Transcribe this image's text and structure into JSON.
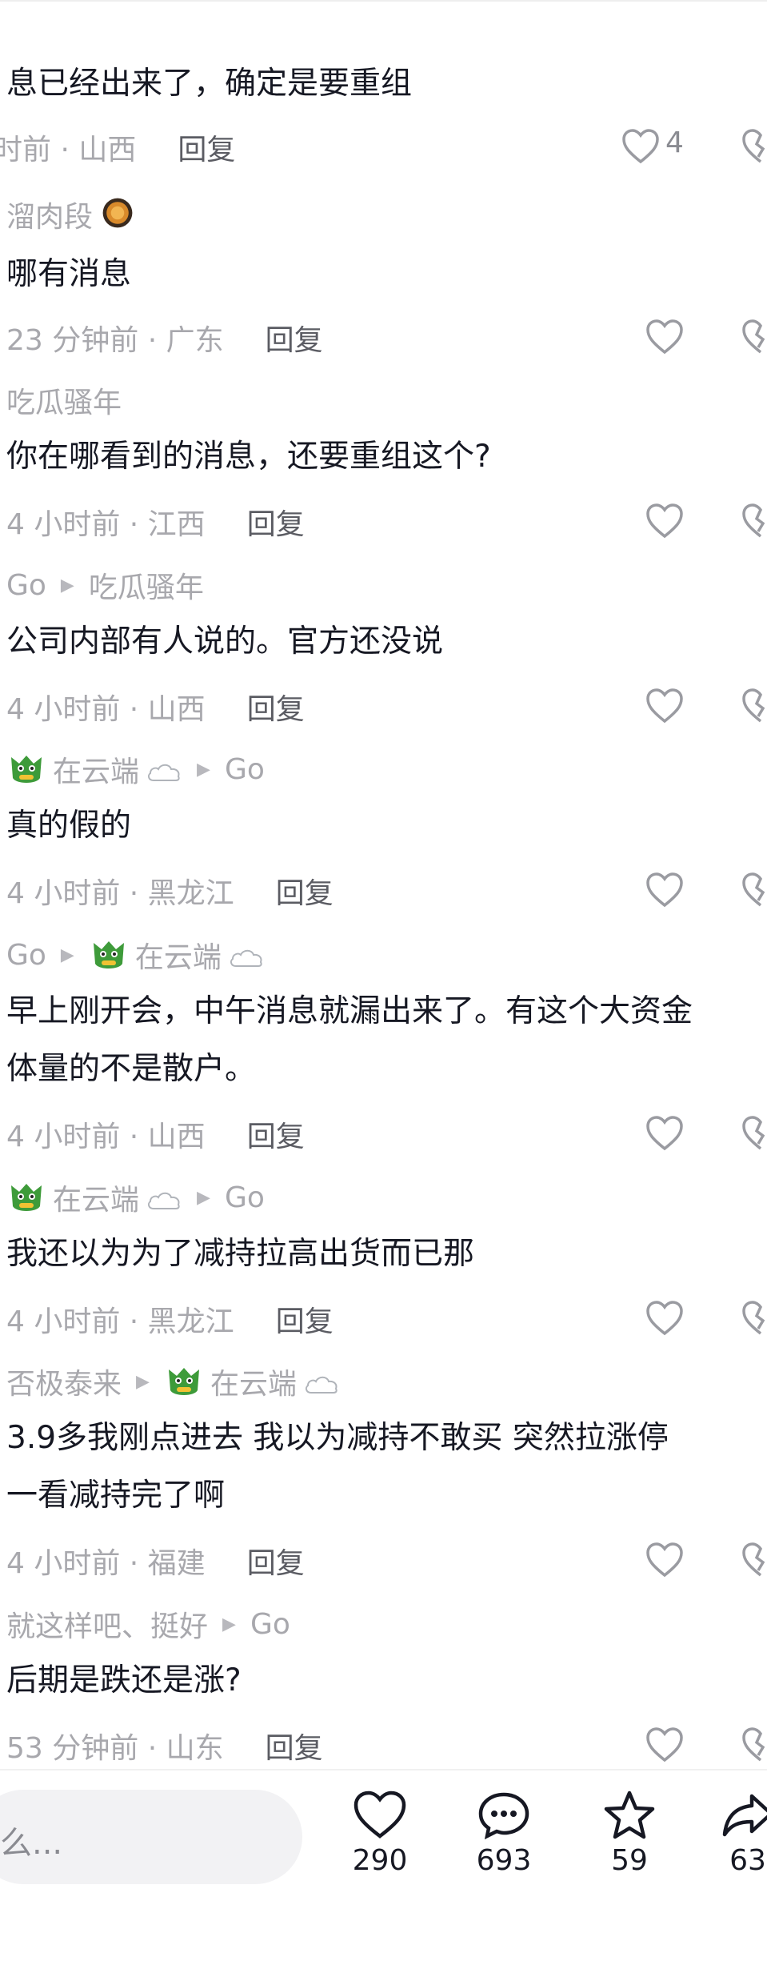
{
  "comments": [
    {
      "text": "息已经出来了，确定是要重组",
      "time": "时前 · 山西",
      "reply": "回复",
      "likes": "4"
    },
    {
      "user": "溜肉段",
      "text": "哪有消息",
      "time": "23 分钟前 · 广东",
      "reply": "回复"
    },
    {
      "user": "吃瓜骚年",
      "text": "你在哪看到的消息，还要重组这个?",
      "time": "4 小时前 · 江西",
      "reply": "回复"
    },
    {
      "user": "Go",
      "to": "吃瓜骚年",
      "text": "公司内部有人说的。官方还没说",
      "time": "4 小时前 · 山西",
      "reply": "回复"
    },
    {
      "user": "在云端",
      "to": "Go",
      "text": "真的假的",
      "time": "4 小时前 · 黑龙江",
      "reply": "回复"
    },
    {
      "user": "Go",
      "to": "在云端",
      "text_line1": "早上刚开会，中午消息就漏出来了。有这个大资金",
      "text_line2": "体量的不是散户。",
      "time": "4 小时前 · 山西",
      "reply": "回复"
    },
    {
      "user": "在云端",
      "to": "Go",
      "text": "我还以为为了减持拉高出货而已那",
      "time": "4 小时前 · 黑龙江",
      "reply": "回复"
    },
    {
      "user": "否极泰来",
      "to": "在云端",
      "text_line1": "3.9多我刚点进去 我以为减持不敢买 突然拉涨停",
      "text_line2": "一看减持完了啊",
      "time": "4 小时前 · 福建",
      "reply": "回复"
    },
    {
      "user": "就这样吧、挺好",
      "to": "Go",
      "text": "后期是跌还是涨?",
      "time": "53 分钟前 · 山东",
      "reply": "回复"
    }
  ],
  "bottom_bar": {
    "input_placeholder": "么...",
    "like_count": "290",
    "comment_count": "693",
    "favorite_count": "59",
    "share_count": "63"
  },
  "icons": {
    "like": "heart-outline-icon",
    "comment": "speech-bubble-icon",
    "favorite": "star-outline-icon",
    "share": "share-arrow-icon"
  }
}
